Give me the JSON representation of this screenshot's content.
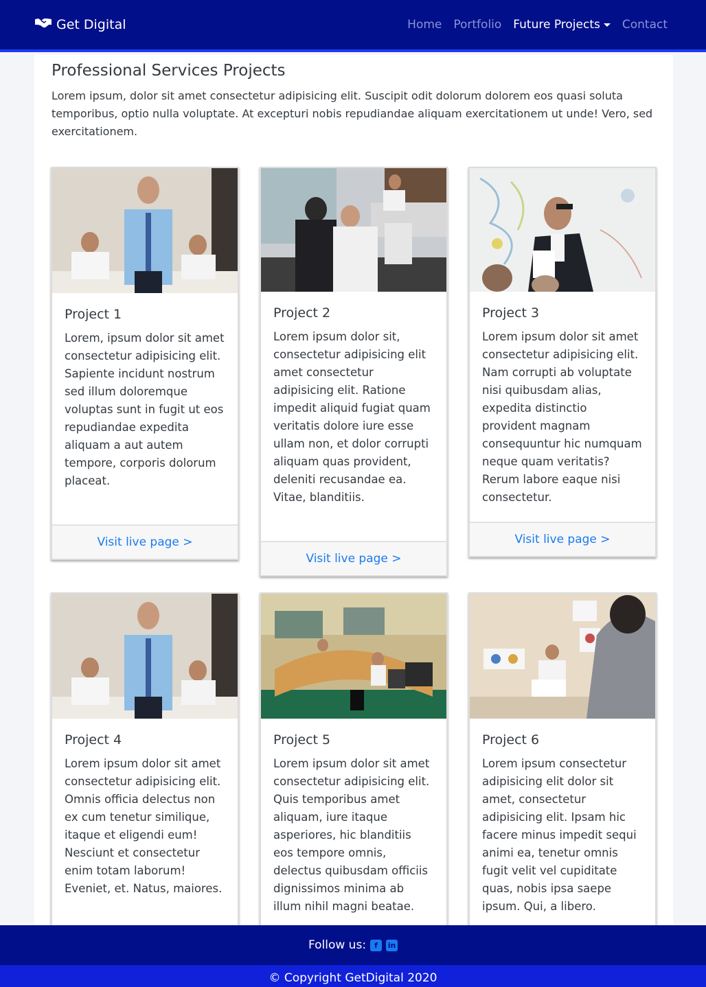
{
  "navbar": {
    "brand": "Get Digital",
    "links": [
      "Home",
      "Portfolio",
      "Future Projects",
      "Contact"
    ]
  },
  "page": {
    "title": "Professional Services Projects",
    "intro": "Lorem ipsum, dolor sit amet consectetur adipisicing elit. Suscipit odit dolorum dolorem eos quasi soluta temporibus, optio nulla voluptate. At excepturi nobis repudiandae aliquam exercitationem ut unde! Vero, sed exercitationem."
  },
  "projects": [
    {
      "title": "Project 1",
      "text": "Lorem, ipsum dolor sit amet consectetur adipisicing elit. Sapiente incidunt nostrum sed illum doloremque voluptas sunt in fugit ut eos repudiandae expedita aliquam a aut autem tempore, corporis dolorum placeat.",
      "link": "Visit live page >"
    },
    {
      "title": "Project 2",
      "text": "Lorem ipsum dolor sit, consectetur adipisicing elit amet consectetur adipisicing elit. Ratione impedit aliquid fugiat quam veritatis dolore iure esse ullam non, et dolor corrupti aliquam quas provident, deleniti recusandae ea. Vitae, blanditiis.",
      "link": "Visit live page >"
    },
    {
      "title": "Project 3",
      "text": "Lorem ipsum dolor sit amet consectetur adipisicing elit. Nam corrupti ab voluptate nisi quibusdam alias, expedita distinctio provident magnam consequuntur hic numquam neque quam veritatis? Rerum labore eaque nisi consectetur.",
      "link": "Visit live page >"
    },
    {
      "title": "Project 4",
      "text": "Lorem ipsum dolor sit amet consectetur adipisicing elit. Omnis officia delectus non ex cum tenetur similique, itaque et eligendi eum! Nesciunt et consectetur enim totam laborum! Eveniet, et. Natus, maiores.",
      "link": ""
    },
    {
      "title": "Project 5",
      "text": "Lorem ipsum dolor sit amet consectetur adipisicing elit. Quis temporibus amet aliquam, iure itaque asperiores, hic blanditiis eos tempore omnis, delectus quibusdam officiis dignissimos minima ab illum nihil magni beatae.",
      "link": ""
    },
    {
      "title": "Project 6",
      "text": "Lorem ipsum consectetur adipisicing elit dolor sit amet, consectetur adipisicing elit. Ipsam hic facere minus impedit sequi animi ea, tenetur omnis fugit velit vel cupiditate quas, nobis ipsa saepe ipsum. Qui, a libero.",
      "link": ""
    }
  ],
  "footer": {
    "follow": "Follow us:",
    "social_icons": [
      "facebook-icon",
      "linkedin-icon"
    ],
    "copyright": "© Copyright GetDigital 2020"
  },
  "colors": {
    "navbar": "#020f8a",
    "footer_copy": "#1021d9",
    "link": "#1a7af0"
  }
}
